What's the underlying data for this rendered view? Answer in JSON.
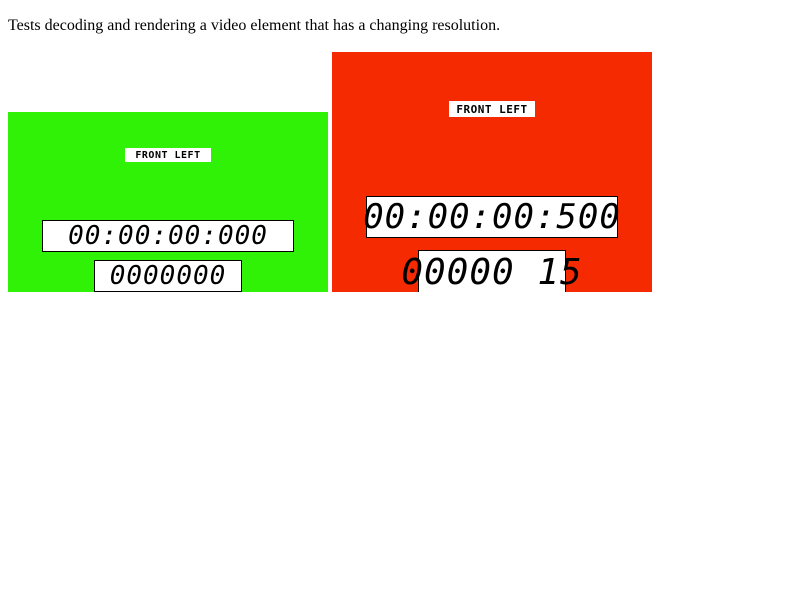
{
  "page": {
    "description": "Tests decoding and rendering a video element that has a changing resolution."
  },
  "videos": [
    {
      "background": "#2ff206",
      "label": "FRONT LEFT",
      "timecode": "00:00:00:000",
      "frame": "0000000"
    },
    {
      "background": "#f52a00",
      "label": "FRONT LEFT",
      "timecode": "00:00:00:500",
      "frame": "00000 15"
    }
  ]
}
